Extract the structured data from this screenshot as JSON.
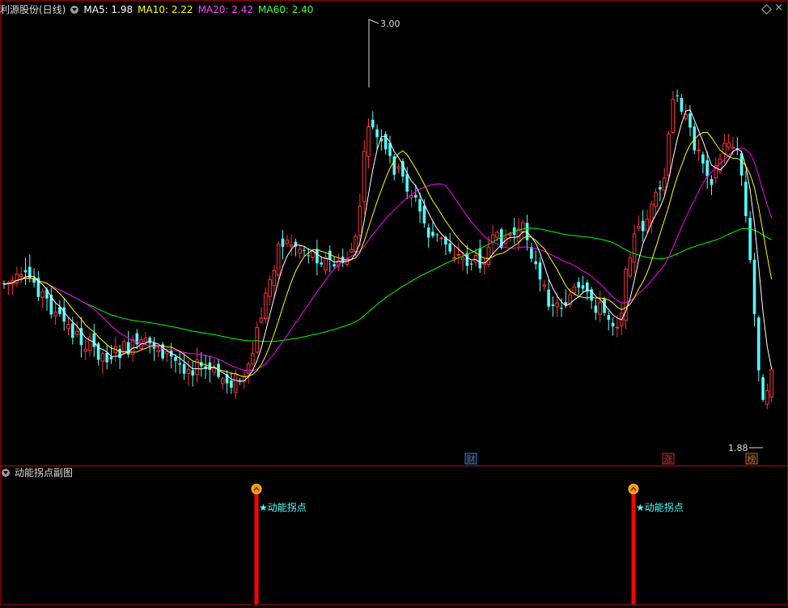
{
  "main_panel": {
    "title": "利源股份(日线)",
    "indicators": [
      {
        "label": "MA5: 1.98",
        "color": "#ffffff"
      },
      {
        "label": "MA10: 2.22",
        "color": "#ffff00"
      },
      {
        "label": "MA20: 2.42",
        "color": "#ff00ff"
      },
      {
        "label": "MA60: 2.40",
        "color": "#00ff00"
      }
    ],
    "high_label": "3.00",
    "low_label": "1.88",
    "event_badges": [
      {
        "text": "财",
        "color": "#3a7bd5"
      },
      {
        "text": "涨",
        "color": "#d02020"
      },
      {
        "text": "榜",
        "color": "#c86a20"
      }
    ]
  },
  "sub_panel": {
    "title": "动能拐点副图",
    "signal_label": "★动能拐点",
    "signal_color": "#ff0000"
  },
  "chart_data": {
    "type": "candlestick",
    "price_range": [
      1.88,
      3.0
    ],
    "ma_periods": [
      5,
      10,
      20,
      60
    ],
    "candle_up_color": "#ff3232",
    "candle_down_color": "#54ffff",
    "signals": 2
  }
}
